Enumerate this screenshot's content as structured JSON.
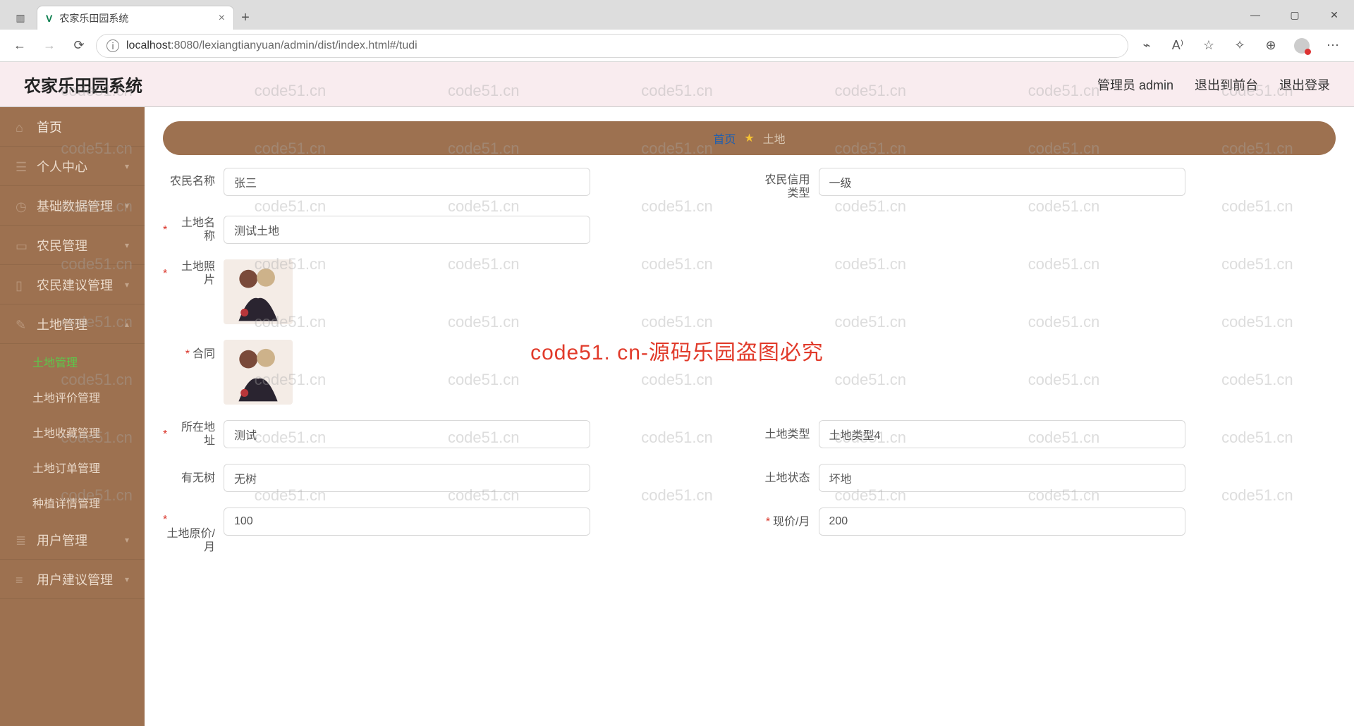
{
  "browser": {
    "tab_title": "农家乐田园系统",
    "url_host": "localhost",
    "url_port": ":8080",
    "url_path": "/lexiangtianyuan/admin/dist/index.html#/tudi"
  },
  "header": {
    "title": "农家乐田园系统",
    "user": "管理员 admin",
    "front": "退出到前台",
    "logout": "退出登录"
  },
  "sidebar": {
    "home": "首页",
    "personal": "个人中心",
    "basic": "基础数据管理",
    "farmer": "农民管理",
    "suggest": "农民建议管理",
    "land": "土地管理",
    "land_sub": {
      "manage": "土地管理",
      "review": "土地评价管理",
      "fav": "土地收藏管理",
      "order": "土地订单管理",
      "plant": "种植详情管理"
    },
    "user": "用户管理",
    "user_suggest": "用户建议管理"
  },
  "crumb": {
    "home": "首页",
    "current": "土地"
  },
  "form": {
    "farmer_name": {
      "label": "农民名称",
      "value": "张三"
    },
    "farmer_credit": {
      "label": "农民信用类型",
      "value": "一级"
    },
    "land_name": {
      "label": "土地名称",
      "value": "测试土地"
    },
    "land_photo": {
      "label": "土地照片"
    },
    "contract": {
      "label": "合同"
    },
    "address": {
      "label": "所在地址",
      "value": "测试"
    },
    "land_type": {
      "label": "土地类型",
      "value": "土地类型4"
    },
    "has_tree": {
      "label": "有无树",
      "value": "无树"
    },
    "land_status": {
      "label": "土地状态",
      "value": "坏地"
    },
    "orig_price": {
      "label": "土地原价/月",
      "value": "100"
    },
    "curr_price": {
      "label": "现价/月",
      "value": "200"
    }
  },
  "watermark_text": "code51.cn",
  "center_watermark": "code51. cn-源码乐园盗图必究"
}
